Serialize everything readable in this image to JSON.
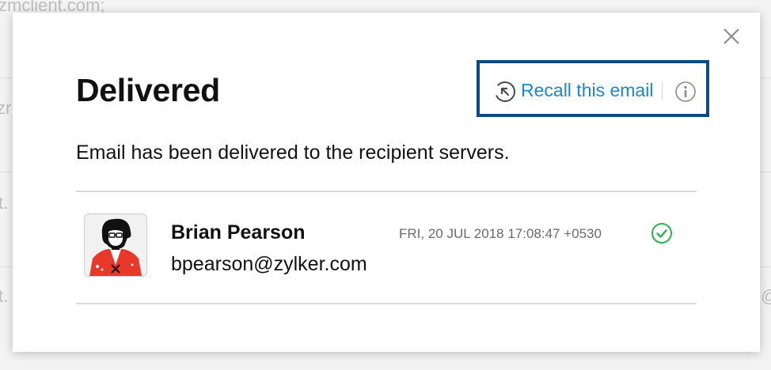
{
  "background": {
    "text_fragments": [
      "zmclient.com;",
      "zr",
      "t.",
      "t.",
      "@"
    ]
  },
  "modal": {
    "title": "Delivered",
    "subtitle": "Email has been delivered to the recipient servers.",
    "recall": {
      "label": "Recall this email",
      "icon": "recall-arrow-icon",
      "info_icon": "info-icon",
      "highlight_color": "#0d4a82",
      "link_color": "#1a86d8"
    },
    "close_icon": "close-icon",
    "recipient": {
      "name": "Brian Pearson",
      "email": "bpearson@zylker.com",
      "timestamp": "FRI, 20 JUL 2018 17:08:47 +0530",
      "status_icon": "check-circle-icon",
      "status_color": "#2bb24c"
    }
  }
}
